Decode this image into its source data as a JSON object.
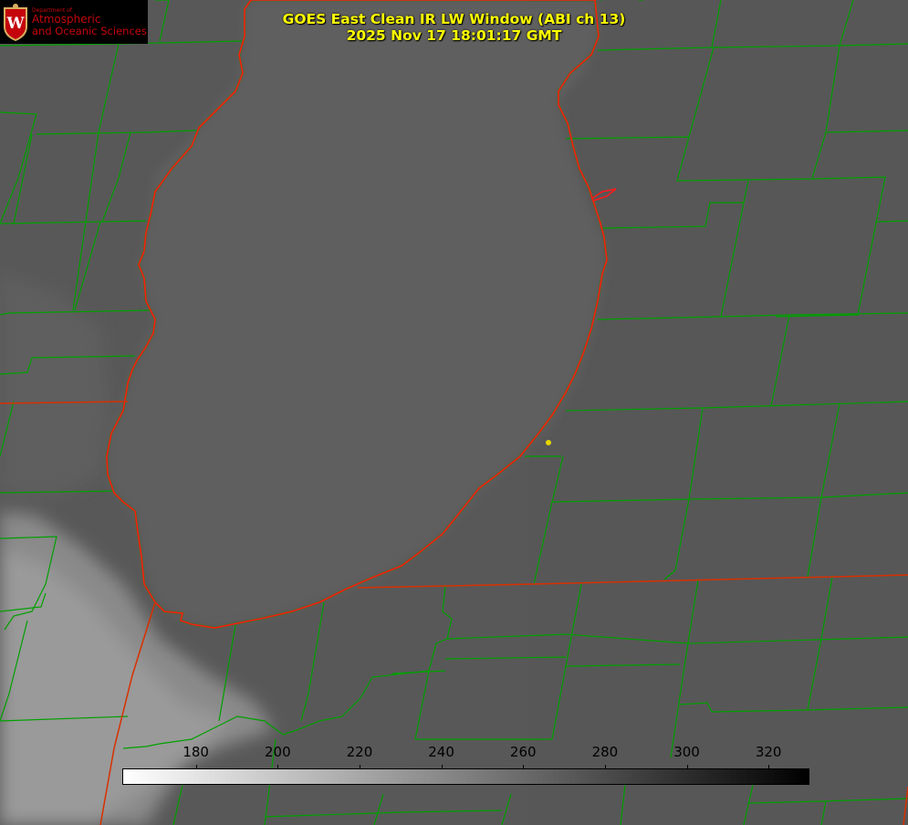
{
  "title": {
    "line1": "GOES East Clean IR LW Window (ABI ch 13)",
    "line2": "2025 Nov 17 18:01:17 GMT"
  },
  "logo": {
    "department": "Department of",
    "line1": "Atmospheric",
    "line2": "and Oceanic Sciences",
    "seal_letter": "W"
  },
  "colorbar": {
    "min": 162,
    "max": 330,
    "ticks": [
      "180",
      "200",
      "220",
      "240",
      "260",
      "280",
      "300",
      "320"
    ],
    "tick_values": [
      180,
      200,
      220,
      240,
      260,
      280,
      300,
      320
    ],
    "colors": [
      "#ffffff",
      "#000000"
    ]
  },
  "map_colors": {
    "county_lines": "#00a000",
    "state_lines": "#e03000",
    "lake_outline": "#ff1a1a",
    "station_dot": "#e6d800"
  }
}
